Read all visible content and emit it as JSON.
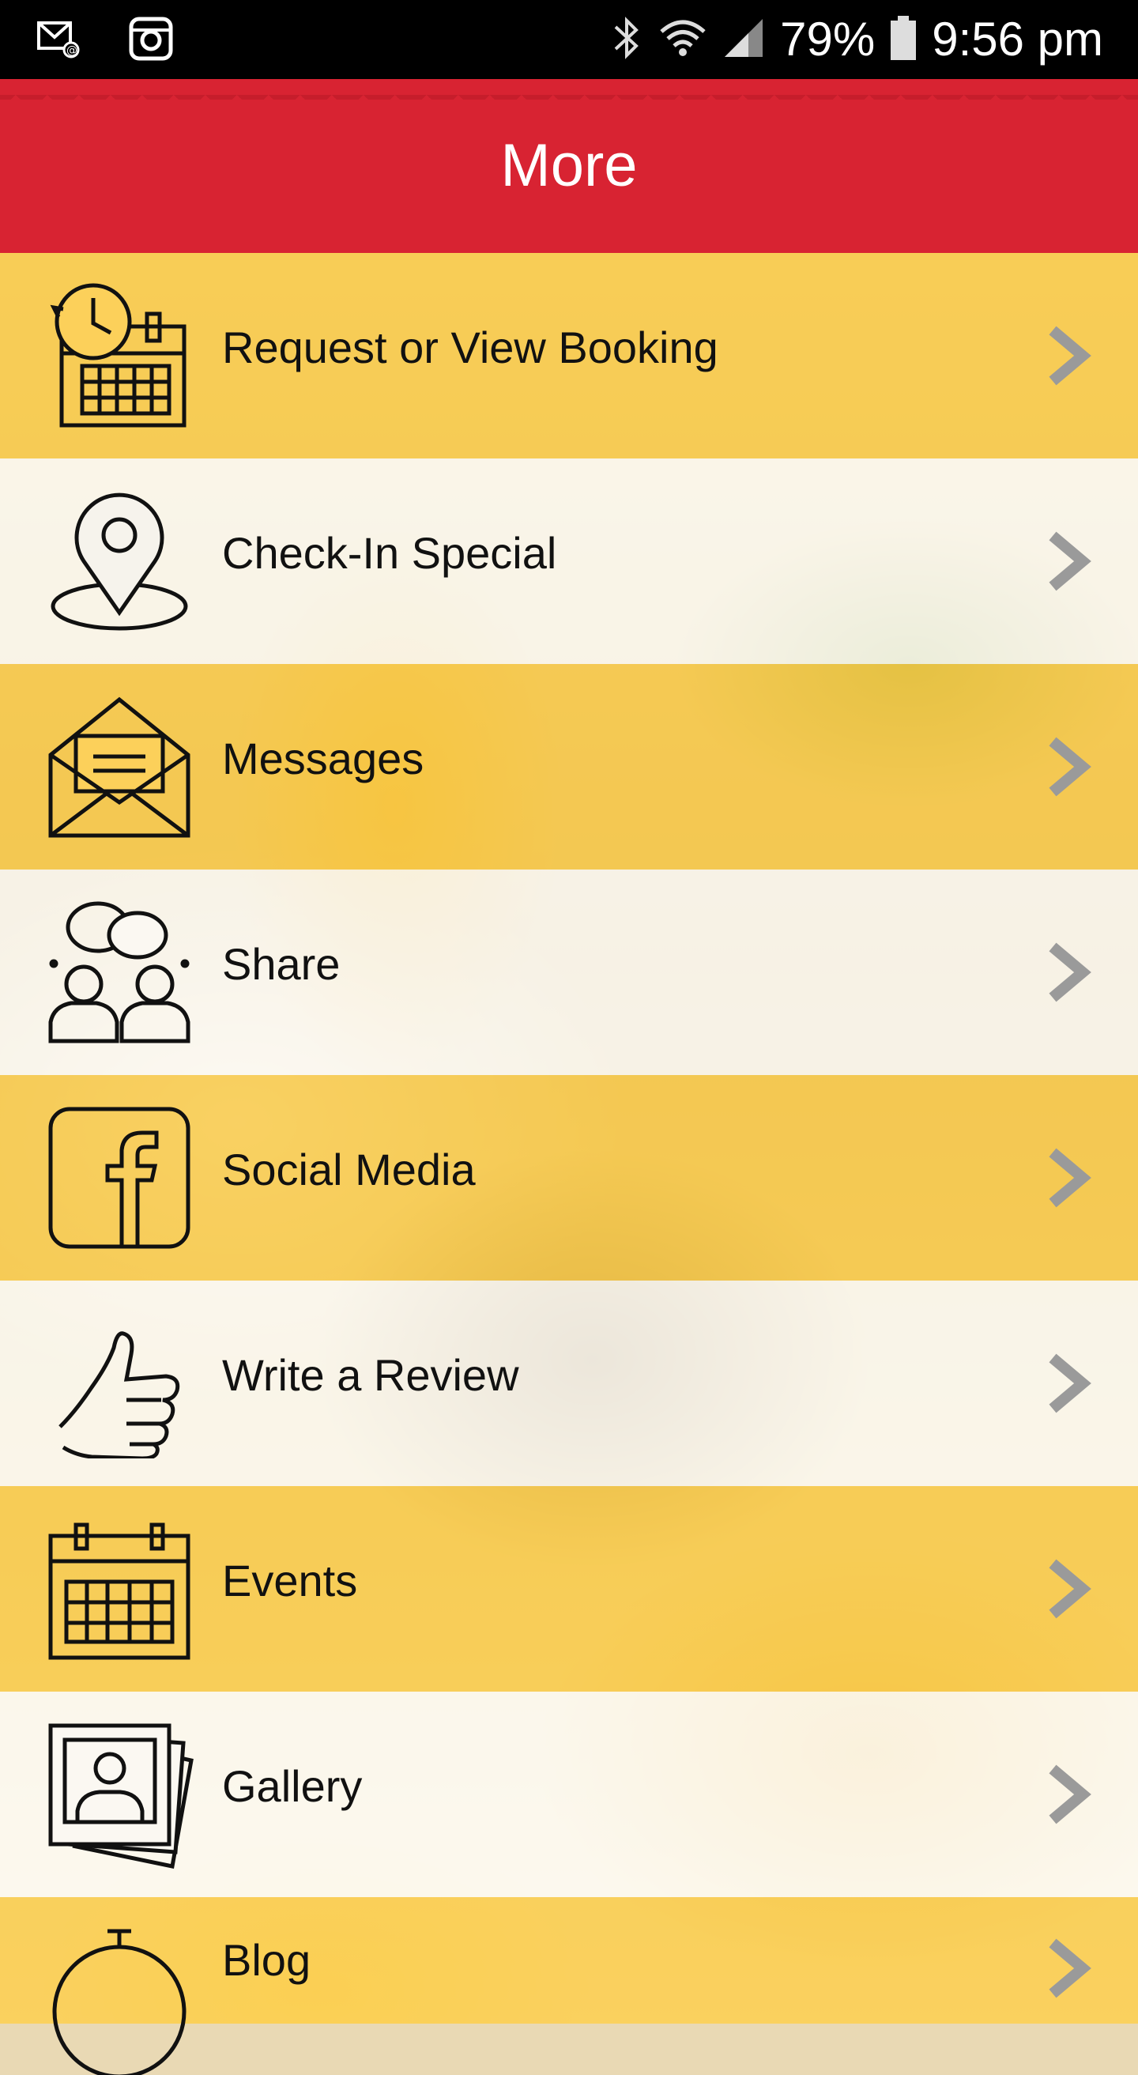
{
  "status_bar": {
    "left_icons": [
      "gallery-email-icon",
      "instagram-icon"
    ],
    "right_icons": [
      "bluetooth-icon",
      "wifi-icon",
      "signal-icon",
      "battery-icon"
    ],
    "battery": "79%",
    "time": "9:56 pm"
  },
  "header": {
    "title": "More",
    "color": "#d82332"
  },
  "menu": {
    "items": [
      {
        "label": "Request or View Booking",
        "icon": "booking-calendar-clock-icon"
      },
      {
        "label": "Check-In Special",
        "icon": "location-pin-icon"
      },
      {
        "label": "Messages",
        "icon": "envelope-icon"
      },
      {
        "label": "Share",
        "icon": "people-chat-icon"
      },
      {
        "label": "Social Media",
        "icon": "facebook-icon"
      },
      {
        "label": "Write a Review",
        "icon": "thumbs-up-icon"
      },
      {
        "label": "Events",
        "icon": "calendar-icon"
      },
      {
        "label": "Gallery",
        "icon": "photo-gallery-icon"
      },
      {
        "label": "Blog",
        "icon": "stopwatch-icon"
      }
    ]
  }
}
